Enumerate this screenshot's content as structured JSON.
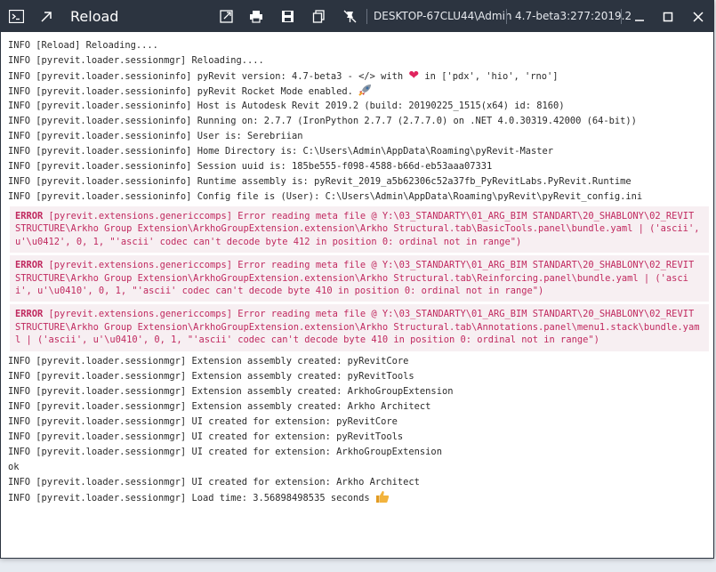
{
  "window": {
    "title": "Reload",
    "machine": "DESKTOP-67CLU44\\Admin",
    "version": "4.7-beta3:277:2019.2"
  },
  "log": {
    "lines_top": [
      "INFO [Reload] Reloading....",
      "INFO [pyrevit.loader.sessionmgr] Reloading....",
      "INFO [pyrevit.loader.sessioninfo] pyRevit version: 4.7-beta3 - </> with",
      "INFO [pyrevit.loader.sessioninfo] pyRevit Rocket Mode enabled.",
      "INFO [pyrevit.loader.sessioninfo] Host is Autodesk Revit 2019.2 (build: 20190225_1515(x64) id: 8160)",
      "INFO [pyrevit.loader.sessioninfo] Running on: 2.7.7 (IronPython 2.7.7 (2.7.7.0) on .NET 4.0.30319.42000 (64-bit))",
      "INFO [pyrevit.loader.sessioninfo] User is: Serebriian",
      "INFO [pyrevit.loader.sessioninfo] Home Directory is: C:\\Users\\Admin\\AppData\\Roaming\\pyRevit-Master",
      "INFO [pyrevit.loader.sessioninfo] Session uuid is: 185be555-f098-4588-b66d-eb53aaa07331",
      "INFO [pyrevit.loader.sessioninfo] Runtime assembly is: pyRevit_2019_a5b62306c52a37fb_PyRevitLabs.PyRevit.Runtime",
      "INFO [pyrevit.loader.sessioninfo] Config file is (User): C:\\Users\\Admin\\AppData\\Roaming\\pyRevit\\pyRevit_config.ini"
    ],
    "version_suffix": "in ['pdx', 'hio', 'rno']",
    "errors": [
      {
        "label": "ERROR",
        "text": "[pyrevit.extensions.genericcomps] Error reading meta file @ Y:\\03_STANDARTY\\01_ARG_BIM STANDART\\20_SHABLONY\\02_REVIT STRUCTURE\\Arkho Group Extension\\ArkhoGroupExtension.extension\\Arkho Structural.tab\\BasicTools.panel\\bundle.yaml | ('ascii', u'\\u0412', 0, 1, \"'ascii' codec can't decode byte 412 in position 0: ordinal not in range\")"
      },
      {
        "label": "ERROR",
        "text": "[pyrevit.extensions.genericcomps] Error reading meta file @ Y:\\03_STANDARTY\\01_ARG_BIM STANDART\\20_SHABLONY\\02_REVIT STRUCTURE\\Arkho Group Extension\\ArkhoGroupExtension.extension\\Arkho Structural.tab\\Reinforcing.panel\\bundle.yaml | ('ascii', u'\\u0410', 0, 1, \"'ascii' codec can't decode byte 410 in position 0: ordinal not in range\")"
      },
      {
        "label": "ERROR",
        "text": "[pyrevit.extensions.genericcomps] Error reading meta file @ Y:\\03_STANDARTY\\01_ARG_BIM STANDART\\20_SHABLONY\\02_REVIT STRUCTURE\\Arkho Group Extension\\ArkhoGroupExtension.extension\\Arkho Structural.tab\\Annotations.panel\\menu1.stack\\bundle.yaml | ('ascii', u'\\u0410', 0, 1, \"'ascii' codec can't decode byte 410 in position 0: ordinal not in range\")"
      }
    ],
    "lines_bottom": [
      "INFO [pyrevit.loader.sessionmgr] Extension assembly created: pyRevitCore",
      "INFO [pyrevit.loader.sessionmgr] Extension assembly created: pyRevitTools",
      "INFO [pyrevit.loader.sessionmgr] Extension assembly created: ArkhoGroupExtension",
      "INFO [pyrevit.loader.sessionmgr] Extension assembly created: Arkho Architect",
      "INFO [pyrevit.loader.sessionmgr] UI created for extension: pyRevitCore",
      "INFO [pyrevit.loader.sessionmgr] UI created for extension: pyRevitTools",
      "INFO [pyrevit.loader.sessionmgr] UI created for extension: ArkhoGroupExtension",
      "ok",
      "INFO [pyrevit.loader.sessionmgr] UI created for extension: Arkho Architect",
      "INFO [pyrevit.loader.sessionmgr] Load time: 3.56898498535 seconds"
    ]
  },
  "icons": {
    "heart": "heart-icon",
    "rocket": "rocket-icon",
    "thumbs_up": "thumbs-up-icon"
  },
  "colors": {
    "titlebar": "#2c3440",
    "error_text": "#c0295f",
    "error_bg": "#f7eff2",
    "info_text": "#2a2a2a"
  }
}
